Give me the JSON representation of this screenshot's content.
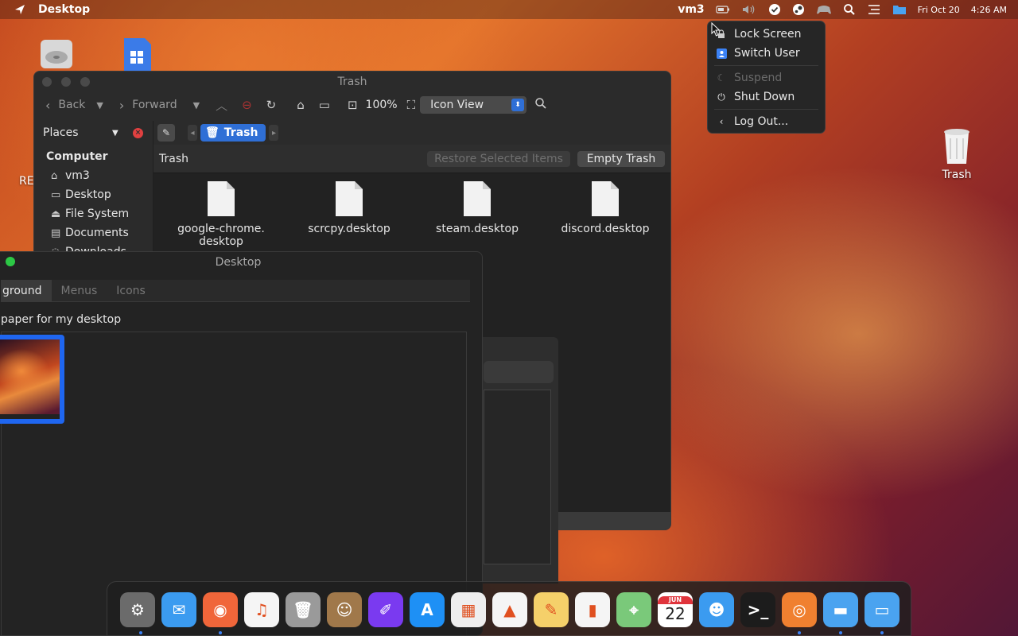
{
  "topbar": {
    "app_title": "Desktop",
    "user": "vm3",
    "date": "Fri Oct 20",
    "time": "4:26 AM",
    "icons": [
      "launcher-icon",
      "battery-icon",
      "volume-icon",
      "check-circle-icon",
      "steam-icon",
      "gamepad-icon",
      "search-icon",
      "list-icon",
      "folder-icon"
    ]
  },
  "user_menu": {
    "items": [
      {
        "label": "Lock Screen",
        "icon": "lock-icon",
        "enabled": true
      },
      {
        "label": "Switch User",
        "icon": "user-icon",
        "enabled": true
      },
      {
        "label": "Suspend",
        "icon": "moon-icon",
        "enabled": false
      },
      {
        "label": "Shut Down",
        "icon": "power-icon",
        "enabled": true
      },
      {
        "label": "Log Out...",
        "icon": "chevron-left-icon",
        "enabled": true
      }
    ]
  },
  "desktop_icons": {
    "trash_label": "Trash",
    "partial_label": "RE"
  },
  "file_manager": {
    "title": "Trash",
    "toolbar": {
      "back": "Back",
      "forward": "Forward",
      "zoom": "100%",
      "view": "Icon View"
    },
    "path": {
      "crumb": "Trash"
    },
    "sidebar": {
      "header": "Places",
      "section": "Computer",
      "items": [
        {
          "label": "vm3",
          "icon": "home-icon"
        },
        {
          "label": "Desktop",
          "icon": "desktop-icon"
        },
        {
          "label": "File System",
          "icon": "drive-icon"
        },
        {
          "label": "Documents",
          "icon": "documents-icon"
        },
        {
          "label": "Downloads",
          "icon": "downloads-icon"
        }
      ]
    },
    "infobar": {
      "label": "Trash",
      "restore": "Restore Selected Items",
      "empty": "Empty Trash"
    },
    "files": [
      {
        "line1": "google-chrome.",
        "line2": "desktop"
      },
      {
        "line1": "scrcpy.desktop",
        "line2": ""
      },
      {
        "line1": "steam.desktop",
        "line2": ""
      },
      {
        "line1": "discord.desktop",
        "line2": ""
      }
    ]
  },
  "desktop_prefs": {
    "title": "Desktop",
    "tabs": [
      "ground",
      "Menus",
      "Icons"
    ],
    "label": "paper for my desktop"
  },
  "dock": {
    "apps": [
      {
        "name": "system-preferences-icon",
        "color": "#6b6b6b"
      },
      {
        "name": "mail-icon",
        "color": "#3b9bf0"
      },
      {
        "name": "firefox-icon",
        "color": "#f0663a"
      },
      {
        "name": "music-icon",
        "color": "#f5f5f5"
      },
      {
        "name": "trash-icon",
        "color": "#9a9a9a"
      },
      {
        "name": "contacts-icon",
        "color": "#a0784a"
      },
      {
        "name": "gimp-icon",
        "color": "#7a3af0"
      },
      {
        "name": "app-store-icon",
        "color": "#1e90f5"
      },
      {
        "name": "launchpad-icon",
        "color": "#eeeeee"
      },
      {
        "name": "vlc-icon",
        "color": "#f5f5f5"
      },
      {
        "name": "drawing-icon",
        "color": "#f5d06a"
      },
      {
        "name": "numbers-icon",
        "color": "#f5f5f5"
      },
      {
        "name": "maps-icon",
        "color": "#7ac97a"
      },
      {
        "name": "calendar-icon",
        "color": "#ffffff"
      },
      {
        "name": "finder-icon",
        "color": "#3b9bf0"
      },
      {
        "name": "terminal-icon",
        "color": "#1c1c1c"
      },
      {
        "name": "ubuntu-icon",
        "color": "#f08030"
      },
      {
        "name": "folder-icon",
        "color": "#4aa3f0"
      },
      {
        "name": "files-icon",
        "color": "#4aa3f0"
      }
    ],
    "calendar": {
      "month": "JUN",
      "day": "22"
    }
  }
}
